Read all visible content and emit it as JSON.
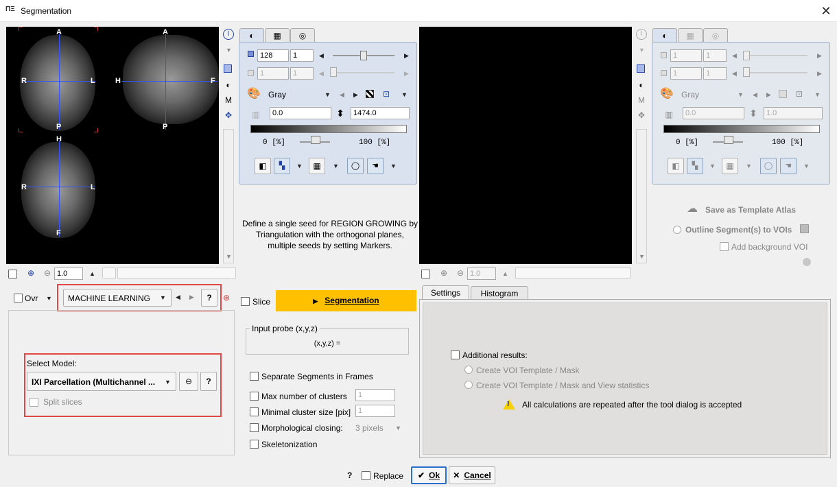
{
  "window": {
    "title": "Segmentation",
    "close": "✕"
  },
  "left_viewer": {
    "axial": {
      "top": "A",
      "left": "R",
      "right": "L",
      "bottom": "P"
    },
    "sagittal": {
      "top": "A",
      "left": "H",
      "right": "F",
      "bottom": "P"
    },
    "coronal": {
      "top": "H",
      "left": "R",
      "right": "L",
      "bottom": "F"
    },
    "zoom": "1.0"
  },
  "right_viewer": {
    "zoom": "1.0"
  },
  "toolbar_side_icons": [
    "I",
    "M"
  ],
  "left_lut": {
    "frame": "128",
    "frame2": "1",
    "plane": "1",
    "plane2": "1",
    "colormap": "Gray",
    "min": "0.0",
    "max": "1474.0",
    "pct_min": "0 [%]",
    "pct_max": "100 [%]"
  },
  "right_lut": {
    "frame": "1",
    "frame2": "1",
    "plane": "1",
    "plane2": "1",
    "colormap": "Gray",
    "min": "0.0",
    "max": "1.0",
    "pct_min": "0 [%]",
    "pct_max": "100 [%]"
  },
  "instructions": "Define a single seed for REGION GROWING by Triangulation with the orthogonal planes, multiple seeds by setting Markers.",
  "right_actions": {
    "save_template": "Save as Template Atlas",
    "outline": "Outline Segment(s) to VOIs",
    "add_bg": "Add background VOI"
  },
  "method": {
    "ovr": "Ovr",
    "selected": "MACHINE LEARNING",
    "help": "?"
  },
  "model": {
    "label": "Select Model:",
    "selected": "IXI Parcellation (Multichannel ...",
    "help": "?",
    "split": "Split slices"
  },
  "segmentation": {
    "slice": "Slice",
    "button": "Segmentation",
    "probe_title": "Input probe (x,y,z)",
    "probe_value": "(x,y,z) =",
    "separate": "Separate Segments in Frames",
    "max_clusters": "Max number of clusters",
    "max_clusters_val": "1",
    "min_cluster": "Minimal cluster size [pix]",
    "min_cluster_val": "1",
    "morph": "Morphological closing:",
    "morph_val": "3 pixels",
    "skeleton": "Skeletonization"
  },
  "tabs": [
    "Settings",
    "Histogram"
  ],
  "settings": {
    "additional": "Additional results:",
    "opt1": "Create VOI Template / Mask",
    "opt2": "Create VOI Template / Mask and View statistics",
    "warning": "All calculations are repeated after the tool dialog is accepted"
  },
  "footer": {
    "help": "?",
    "replace": "Replace",
    "ok": "Ok",
    "cancel": "Cancel"
  }
}
